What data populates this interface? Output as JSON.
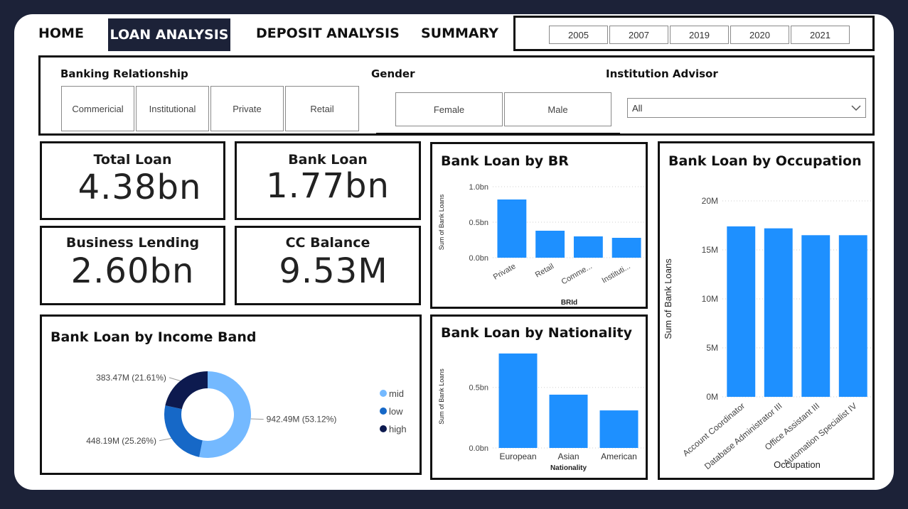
{
  "nav": {
    "home": "HOME",
    "loan_analysis": "LOAN ANALYSIS",
    "deposit_analysis": "DEPOSIT ANALYSIS",
    "summary": "SUMMARY"
  },
  "years": [
    "2005",
    "2007",
    "2019",
    "2020",
    "2021"
  ],
  "filters": {
    "banking_relationship": {
      "title": "Banking Relationship",
      "options": [
        "Commericial",
        "Institutional",
        "Private",
        "Retail"
      ]
    },
    "gender": {
      "title": "Gender",
      "options": [
        "Female",
        "Male"
      ]
    },
    "institution_advisor": {
      "title": "Institution Advisor",
      "selected": "All"
    }
  },
  "kpis": {
    "total_loan": {
      "label": "Total Loan",
      "value": "4.38bn"
    },
    "bank_loan": {
      "label": "Bank Loan",
      "value": "1.77bn"
    },
    "business_lending": {
      "label": "Business Lending",
      "value": "2.60bn"
    },
    "cc_balance": {
      "label": "CC Balance",
      "value": "9.53M"
    }
  },
  "colors": {
    "bar": "#1e90ff",
    "mid": "#74b9ff",
    "low": "#1668c7",
    "high": "#0d1a4f",
    "nav_active": "#1c2238"
  },
  "chart_data": [
    {
      "type": "bar",
      "title": "Bank Loan by BR",
      "xlabel": "BRId",
      "ylabel": "Sum of Bank Loans",
      "categories": [
        "Private",
        "Retail",
        "Comme...",
        "Instituti..."
      ],
      "values": [
        0.82,
        0.38,
        0.3,
        0.28
      ],
      "ylim": [
        0,
        1.0
      ],
      "ticks": [
        {
          "v": 0,
          "label": "0.0bn"
        },
        {
          "v": 0.5,
          "label": "0.5bn"
        },
        {
          "v": 1.0,
          "label": "1.0bn"
        }
      ],
      "grid": true
    },
    {
      "type": "bar",
      "title": "Bank Loan by Nationality",
      "xlabel": "Nationality",
      "ylabel": "Sum of Bank Loans",
      "categories": [
        "European",
        "Asian",
        "American"
      ],
      "values": [
        0.78,
        0.44,
        0.31
      ],
      "ylim": [
        0,
        0.85
      ],
      "ticks": [
        {
          "v": 0,
          "label": "0.0bn"
        },
        {
          "v": 0.5,
          "label": "0.5bn"
        }
      ],
      "grid": true
    },
    {
      "type": "bar",
      "title": "Bank Loan by Occupation",
      "xlabel": "Occupation",
      "ylabel": "Sum of Bank Loans",
      "categories": [
        "Account Coordinator",
        "Database Administrator III",
        "Office Assistant III",
        "Automation Specialist IV"
      ],
      "values": [
        17.4,
        17.2,
        16.5,
        16.5
      ],
      "ylim": [
        0,
        20
      ],
      "ticks": [
        {
          "v": 0,
          "label": "0M"
        },
        {
          "v": 5,
          "label": "5M"
        },
        {
          "v": 10,
          "label": "10M"
        },
        {
          "v": 15,
          "label": "15M"
        },
        {
          "v": 20,
          "label": "20M"
        }
      ],
      "grid": true
    },
    {
      "type": "pie",
      "title": "Bank Loan by Income Band",
      "slices": [
        {
          "name": "mid",
          "value": 942.49,
          "label": "942.49M (53.12%)"
        },
        {
          "name": "low",
          "value": 448.19,
          "label": "448.19M (25.26%)"
        },
        {
          "name": "high",
          "value": 383.47,
          "label": "383.47M (21.61%)"
        }
      ],
      "legend": [
        "mid",
        "low",
        "high"
      ],
      "legend_position": "right"
    }
  ]
}
